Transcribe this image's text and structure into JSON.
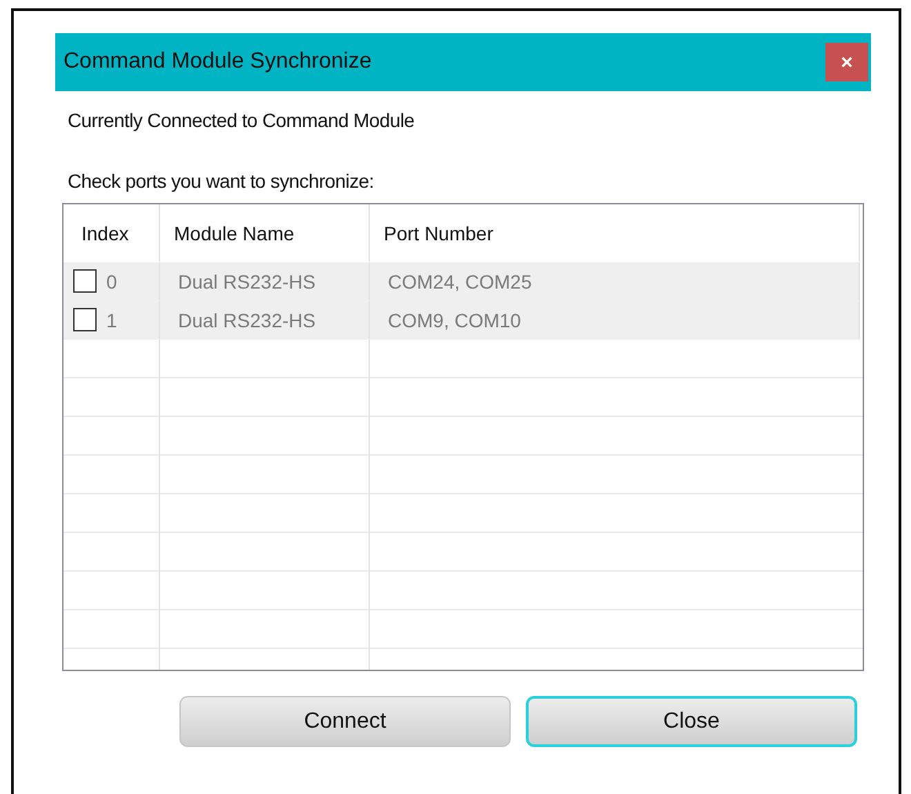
{
  "window": {
    "title": "Command Module Synchronize",
    "close_label": "×"
  },
  "status_text": "Currently Connected to Command Module",
  "instruction": "Check ports you want to synchronize:",
  "table": {
    "columns": [
      "Index",
      "Module Name",
      "Port Number"
    ],
    "rows": [
      {
        "checked": false,
        "index": "0",
        "module_name": "Dual RS232-HS",
        "port_number": "COM24, COM25"
      },
      {
        "checked": false,
        "index": "1",
        "module_name": "Dual RS232-HS",
        "port_number": "COM9, COM10"
      }
    ]
  },
  "buttons": [
    {
      "label": "Connect",
      "focused": false
    },
    {
      "label": "Close",
      "focused": true
    }
  ]
}
